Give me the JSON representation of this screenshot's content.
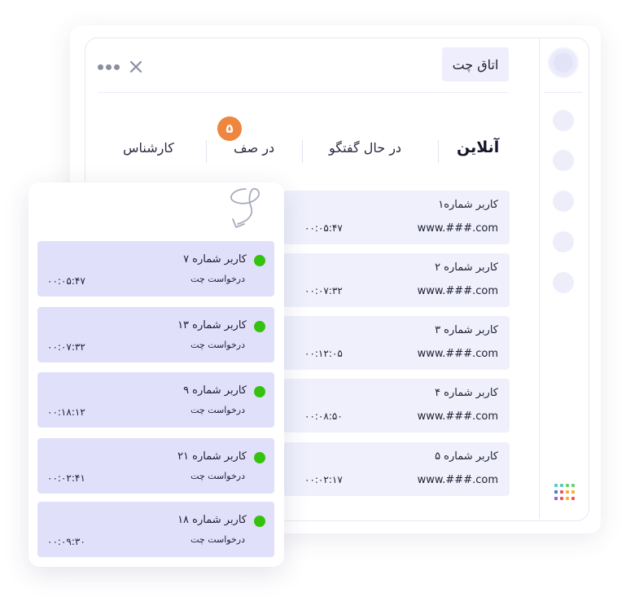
{
  "window": {
    "title": "اتاق چت"
  },
  "tabs": [
    {
      "label": "آنلاین",
      "active": true
    },
    {
      "label": "در حال گفتگو"
    },
    {
      "label": "در صف",
      "badge": "۵"
    },
    {
      "label": "کارشناس"
    }
  ],
  "chats": [
    {
      "name": "کاربر شماره۱",
      "url": "www.###.com",
      "time": "۰۰:۰۵:۴۷"
    },
    {
      "name": "کاربر شماره ۲",
      "url": "www.###.com",
      "time": "۰۰:۰۷:۳۲"
    },
    {
      "name": "کاربر شماره ۳",
      "url": "www.###.com",
      "time": "۰۰:۱۲:۰۵"
    },
    {
      "name": "کاربر شماره ۴",
      "url": "www.###.com",
      "time": "۰۰:۰۸:۵۰"
    },
    {
      "name": "کاربر شماره ۵",
      "url": "www.###.com",
      "time": "۰۰:۰۲:۱۷"
    }
  ],
  "queue": [
    {
      "name": "کاربر شماره ۷",
      "status": "درخواست چت",
      "time": "۰۰:۰۵:۴۷"
    },
    {
      "name": "کاربر شماره ۱۳",
      "status": "درخواست چت",
      "time": "۰۰:۰۷:۳۲"
    },
    {
      "name": "کاربر شماره ۹",
      "status": "درخواست چت",
      "time": "۰۰:۱۸:۱۲"
    },
    {
      "name": "کاربر شماره ۲۱",
      "status": "درخواست چت",
      "time": "۰۰:۰۲:۴۱"
    },
    {
      "name": "کاربر شماره ۱۸",
      "status": "درخواست چت",
      "time": "۰۰:۰۹:۳۰"
    }
  ],
  "colors": {
    "accent_badge": "#ee8640",
    "online_dot": "#35c20f",
    "chat_row_bg": "#eff0fc",
    "queue_row_bg": "#e1e0fb",
    "app_grid": [
      "#5ac8c8",
      "#5ac8c8",
      "#6fd06f",
      "#6fd06f",
      "#4a78d6",
      "#e85a5a",
      "#f2b233",
      "#f2b233",
      "#9a5ad6",
      "#e85a5a",
      "#f2b233",
      "#e85a5a"
    ]
  },
  "icons": [
    "close-icon",
    "more-icon",
    "curved-arrow-icon",
    "apps-grid-icon",
    "online-status-dot"
  ]
}
